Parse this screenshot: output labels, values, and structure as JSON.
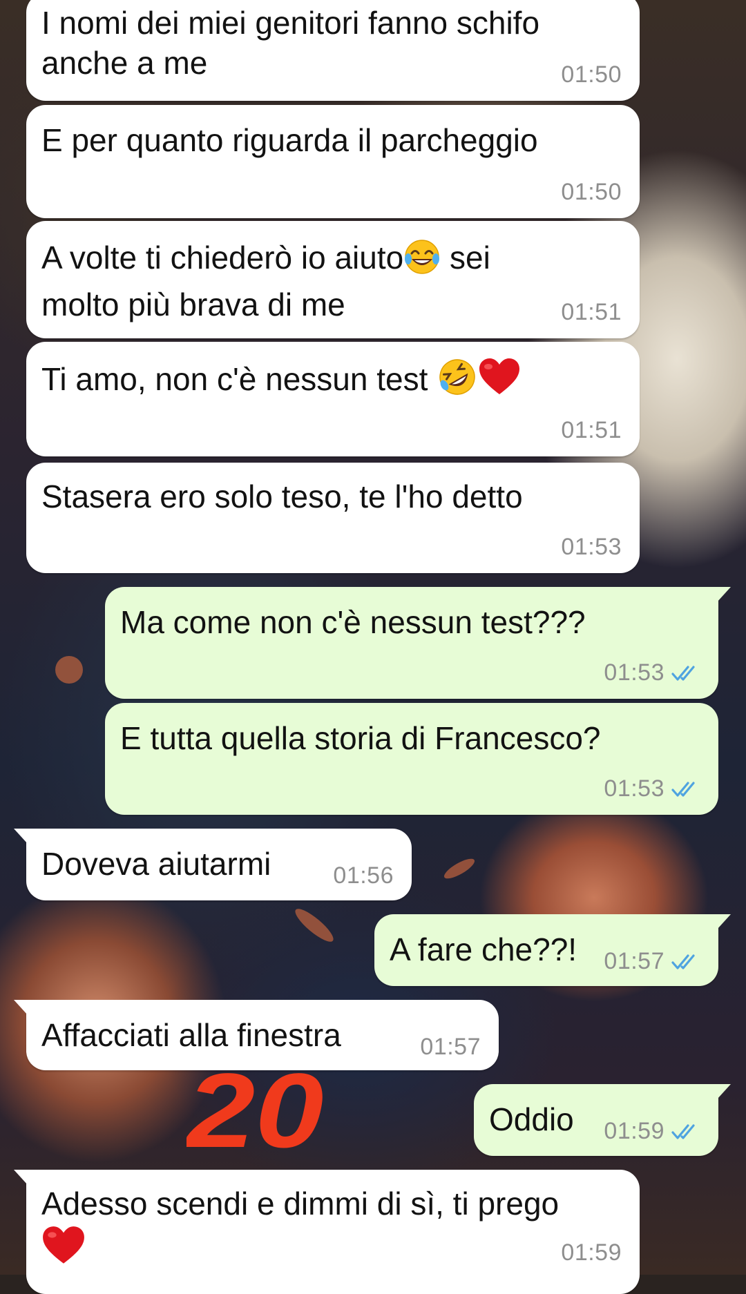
{
  "chat": {
    "messages": [
      {
        "id": "m1",
        "direction": "in",
        "text": "I nomi dei miei genitori fanno schifo\nanche a me",
        "time": "01:50"
      },
      {
        "id": "m2",
        "direction": "in",
        "text": "E per quanto riguarda il parcheggio",
        "time": "01:50"
      },
      {
        "id": "m3",
        "direction": "in",
        "text_part1": "A volte ti chiederò io aiuto",
        "text_part2": " sei\nmolto più brava di me",
        "emoji": "face-with-tears-of-joy",
        "time": "01:51"
      },
      {
        "id": "m4",
        "direction": "in",
        "text": "Ti amo, non c'è nessun test ",
        "emojis": [
          "rolling-on-floor-laughing",
          "red-heart"
        ],
        "time": "01:51"
      },
      {
        "id": "m5",
        "direction": "in",
        "text": "Stasera ero solo teso, te l'ho detto",
        "time": "01:53"
      },
      {
        "id": "m6",
        "direction": "out",
        "text": "Ma come non c'è nessun test???",
        "time": "01:53",
        "status": "read"
      },
      {
        "id": "m7",
        "direction": "out",
        "text": "E tutta quella storia di Francesco?",
        "time": "01:53",
        "status": "read"
      },
      {
        "id": "m8",
        "direction": "in",
        "text": "Doveva aiutarmi",
        "time": "01:56"
      },
      {
        "id": "m9",
        "direction": "out",
        "text": "A fare che??!",
        "time": "01:57",
        "status": "read"
      },
      {
        "id": "m10",
        "direction": "in",
        "text": "Affacciati alla finestra",
        "time": "01:57"
      },
      {
        "id": "m11",
        "direction": "out",
        "text": "Oddio",
        "time": "01:59",
        "status": "read"
      },
      {
        "id": "m12",
        "direction": "in",
        "text": "Adesso scendi e dimmi di sì, ti prego",
        "emoji": "red-heart",
        "time": "01:59"
      }
    ]
  },
  "annotation": {
    "text": "20",
    "color": "#f03a1c"
  },
  "colors": {
    "incoming_bubble": "#ffffff",
    "outgoing_bubble": "#e7fcd6",
    "timestamp": "#8e8e8e",
    "read_ticks": "#4fa3e0"
  }
}
